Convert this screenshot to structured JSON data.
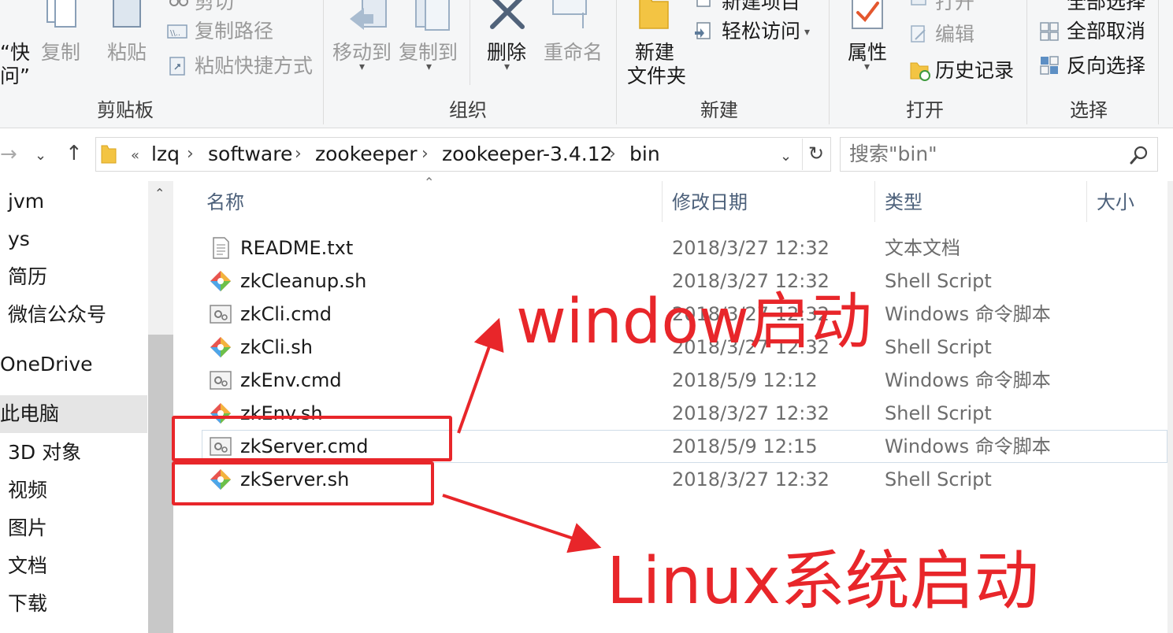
{
  "ribbon": {
    "clipboard": {
      "pin_label_line1": "“快",
      "pin_label_line2": "问”",
      "copy": "复制",
      "paste": "粘贴",
      "cut": "剪切",
      "copy_path": "复制路径",
      "paste_shortcut": "粘贴快捷方式",
      "group": "剪贴板"
    },
    "organize": {
      "move_to": "移动到",
      "copy_to": "复制到",
      "delete": "删除",
      "rename": "重命名",
      "group": "组织"
    },
    "new": {
      "new_folder_line1": "新建",
      "new_folder_line2": "文件夹",
      "new_item": "新建项目",
      "easy_access": "轻松访问",
      "group": "新建"
    },
    "open": {
      "properties": "属性",
      "open": "打开",
      "edit": "编辑",
      "history": "历史记录",
      "group": "打开"
    },
    "select": {
      "select_all": "全部选择",
      "select_none": "全部取消",
      "invert": "反向选择",
      "group": "选择"
    }
  },
  "address": {
    "overflow": "«",
    "crumbs": [
      "lzq",
      "software",
      "zookeeper",
      "zookeeper-3.4.12",
      "bin"
    ],
    "search_placeholder": "搜索\"bin\""
  },
  "nav": {
    "items": [
      "jvm",
      "ys",
      "简历",
      "微信公众号",
      "OneDrive",
      "此电脑",
      "3D 对象",
      "视频",
      "图片",
      "文档",
      "下载"
    ],
    "selected": "此电脑"
  },
  "columns": {
    "name": "名称",
    "date": "修改日期",
    "type": "类型",
    "size": "大小"
  },
  "files": [
    {
      "name": "README.txt",
      "date": "2018/3/27 12:32",
      "type": "文本文档",
      "icon": "text-file-icon"
    },
    {
      "name": "zkCleanup.sh",
      "date": "2018/3/27 12:32",
      "type": "Shell Script",
      "icon": "shell-script-icon"
    },
    {
      "name": "zkCli.cmd",
      "date": "2018/3/27 12:32",
      "type": "Windows 命令脚本",
      "icon": "cmd-script-icon"
    },
    {
      "name": "zkCli.sh",
      "date": "2018/3/27 12:32",
      "type": "Shell Script",
      "icon": "shell-script-icon"
    },
    {
      "name": "zkEnv.cmd",
      "date": "2018/5/9 12:12",
      "type": "Windows 命令脚本",
      "icon": "cmd-script-icon"
    },
    {
      "name": "zkEnv.sh",
      "date": "2018/3/27 12:32",
      "type": "Shell Script",
      "icon": "shell-script-icon"
    },
    {
      "name": "zkServer.cmd",
      "date": "2018/5/9 12:15",
      "type": "Windows 命令脚本",
      "icon": "cmd-script-icon"
    },
    {
      "name": "zkServer.sh",
      "date": "2018/3/27 12:32",
      "type": "Shell Script",
      "icon": "shell-script-icon"
    }
  ],
  "annotations": {
    "windows_label": "window启动",
    "linux_label": "Linux系统启动",
    "color": "#e8262a"
  }
}
